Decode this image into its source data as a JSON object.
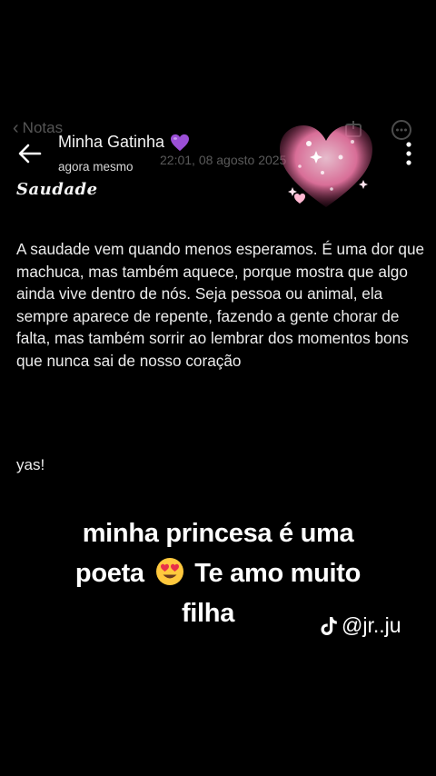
{
  "notes_app": {
    "back_label": "Notas",
    "timestamp": "22:01, 08 agosto 2025"
  },
  "chat_header": {
    "contact_name": "Minha Gatinha",
    "status": "agora mesmo"
  },
  "note": {
    "title": "Saudade",
    "body": "A saudade vem quando menos esperamos. É uma dor que machuca, mas também aquece, porque mostra que algo ainda vive dentro de nós. Seja pessoa ou animal, ela sempre aparece de repente, fazendo a gente chorar de falta, mas também sorrir ao lembrar dos momentos bons que nunca sai de nosso coração",
    "signature": "yas!"
  },
  "caption": {
    "line1": "minha princesa é uma",
    "line2_before": "poeta",
    "line2_after": "Te amo muito",
    "line3": "filha"
  },
  "watermark": {
    "handle": "@jr..ju"
  },
  "icons": {
    "heart_emoji": "purple-heart",
    "caption_emoji": "heart-eyes-face",
    "watermark_logo": "tiktok-logo"
  },
  "colors": {
    "background": "#000000",
    "purple_heart": "#9b4fd6",
    "sticker_pink": "#f07aa8"
  }
}
